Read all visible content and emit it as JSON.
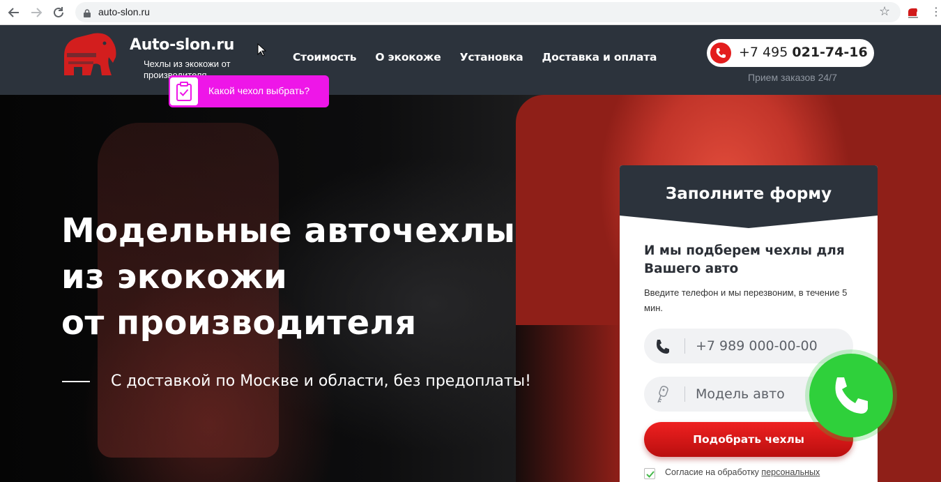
{
  "browser": {
    "url": "auto-slon.ru",
    "icons": [
      "back-icon",
      "forward-icon",
      "reload-icon",
      "lock-icon",
      "star-icon",
      "extension-icon"
    ]
  },
  "header": {
    "logo_name": "Auto-slon.ru",
    "logo_sub": "Чехлы из экокожи от производителя",
    "nav": [
      "Стоимость",
      "О экокоже",
      "Установка",
      "Доставка и оплата"
    ],
    "phone_prefix": "+7 495",
    "phone_main": "021-74-16",
    "hours": "Прием заказов 24/7"
  },
  "quiz": {
    "label": "Какой чехол выбрать?"
  },
  "hero": {
    "title_lines": [
      "Модельные авточехлы",
      "из экокожи",
      "от производителя"
    ],
    "subtitle": "С доставкой по Москве и области, без предоплаты!"
  },
  "form": {
    "title": "Заполните форму",
    "lead": "И мы подберем чехлы для Вашего авто",
    "hint": "Введите телефон и мы перезвоним, в течение 5 мин.",
    "phone_placeholder": "+7 989 000-00-00",
    "model_placeholder": "Модель авто",
    "submit": "Подобрать чехлы",
    "consent_prefix": "Согласие на обработку",
    "consent_link": "персональных"
  },
  "colors": {
    "header_bg": "#2c333c",
    "accent_red": "#e31d1d",
    "quiz_magenta": "#ee16e8",
    "call_green": "#2fd03b"
  }
}
